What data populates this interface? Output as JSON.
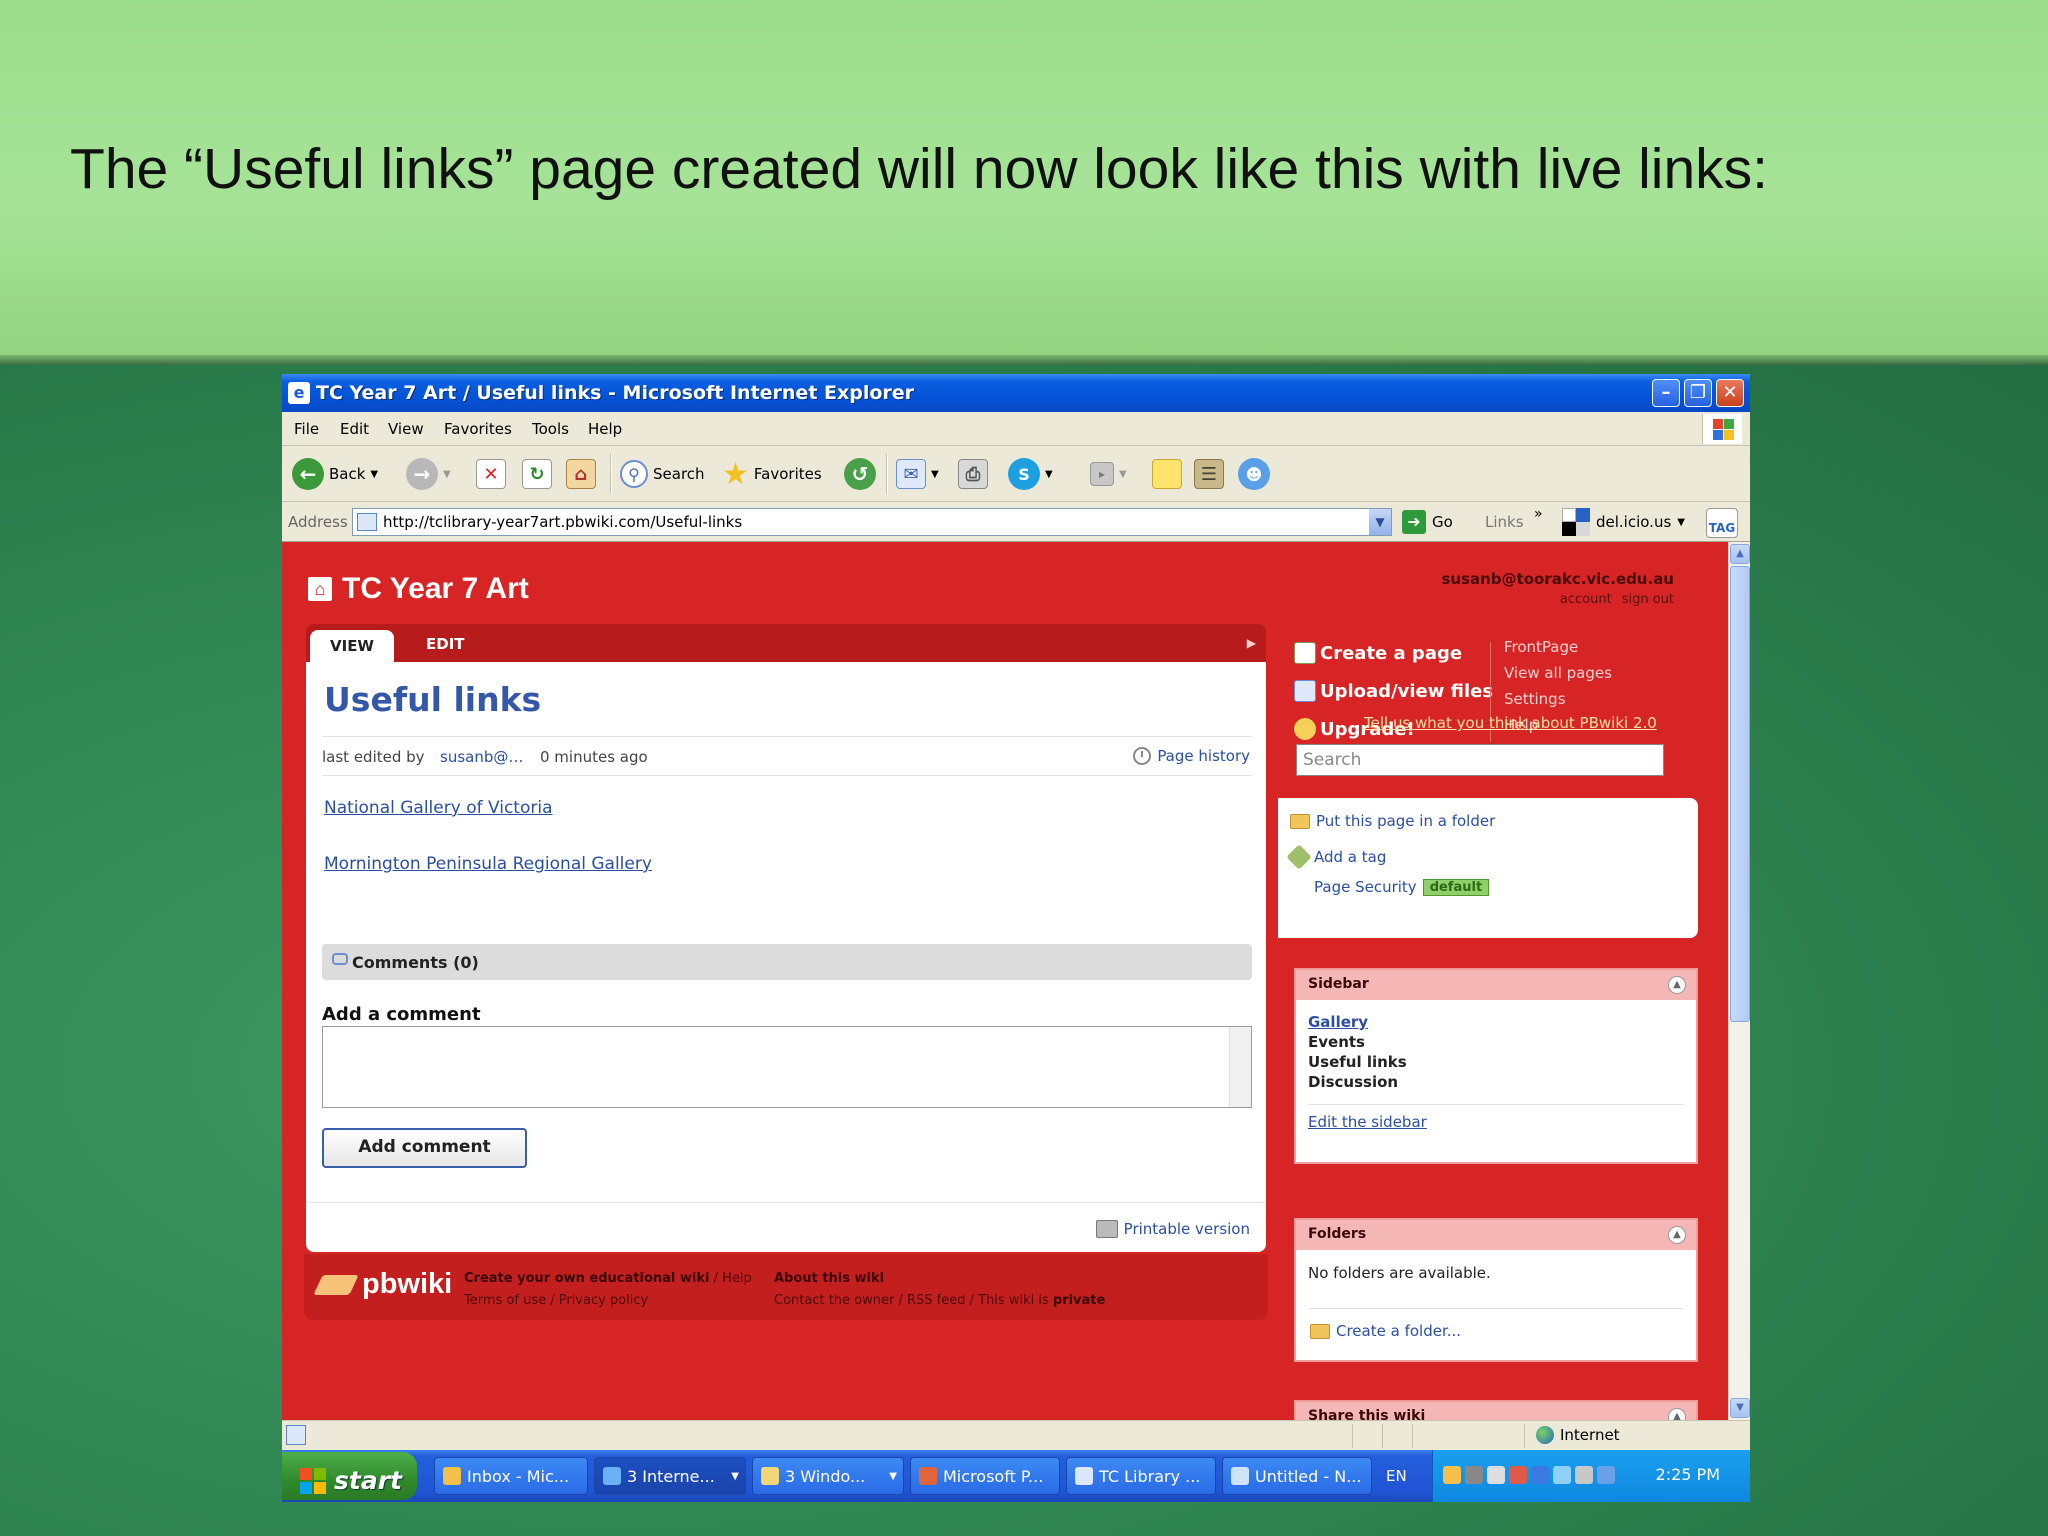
{
  "slide": {
    "caption": "The “Useful links” page created will now look like this with live links:"
  },
  "window": {
    "title": "TC Year 7 Art / Useful links - Microsoft Internet Explorer",
    "menu": [
      "File",
      "Edit",
      "View",
      "Favorites",
      "Tools",
      "Help"
    ],
    "toolbar": {
      "back": "Back",
      "search": "Search",
      "favorites": "Favorites"
    },
    "address": {
      "label": "Address",
      "url": "http://tclibrary-year7art.pbwiki.com/Useful-links",
      "go": "Go",
      "links": "Links",
      "delicious": "del.icio.us",
      "tag": "TAG"
    }
  },
  "page": {
    "site_title": "TC Year 7 Art",
    "user_email": "susanb@toorakc.vic.edu.au",
    "user_links": [
      "account",
      "sign out"
    ],
    "tabs": {
      "view": "VIEW",
      "edit": "EDIT"
    },
    "title": "Useful links",
    "meta": {
      "last_edited": "last edited by",
      "user": "susanb@…",
      "ago": "0 minutes ago",
      "history": "Page history"
    },
    "links": [
      "National Gallery of Victoria",
      "Mornington Peninsula Regional Gallery"
    ],
    "comments_header": "Comments (0)",
    "add_comment_heading": "Add a comment",
    "add_comment_button": "Add comment",
    "printable": "Printable version",
    "footer": {
      "logo": "pbwiki",
      "col1_line1_bold": "Create your own educational wiki",
      "col1_line1_rest": " / Help",
      "col1_line2": "Terms of use / Privacy policy",
      "col2_line1": "About this wiki",
      "col2_line2_a": "Contact the owner / RSS feed / This wiki is ",
      "col2_line2_b": "private"
    },
    "actions": [
      "Create a page",
      "Upload/view files",
      "Upgrade!"
    ],
    "nav": [
      "FrontPage",
      "View all pages",
      "Settings",
      "Help"
    ],
    "feedback": "Tell us what you think about PBwiki 2.0",
    "search_placeholder": "Search",
    "page_options": {
      "folder": "Put this page in a folder",
      "tag": "Add a tag",
      "security": "Page Security",
      "security_badge": "default"
    },
    "sidebar": {
      "header": "Sidebar",
      "items": [
        "Gallery",
        "Events",
        "Useful links",
        "Discussion"
      ],
      "edit": "Edit the sidebar"
    },
    "folders": {
      "header": "Folders",
      "empty": "No folders are available.",
      "create": "Create a folder..."
    },
    "share": {
      "header": "Share this wiki"
    }
  },
  "statusbar": {
    "zone": "Internet"
  },
  "taskbar": {
    "start": "start",
    "tasks": [
      "Inbox - Mic...",
      "3 Interne...",
      "3 Windo...",
      "Microsoft P...",
      "TC Library ...",
      "Untitled - N..."
    ],
    "lang": "EN",
    "clock": "2:25 PM"
  },
  "colors": {
    "page_red": "#d72424",
    "link_blue": "#2b4fa0",
    "xp_blue": "#0453d6"
  }
}
